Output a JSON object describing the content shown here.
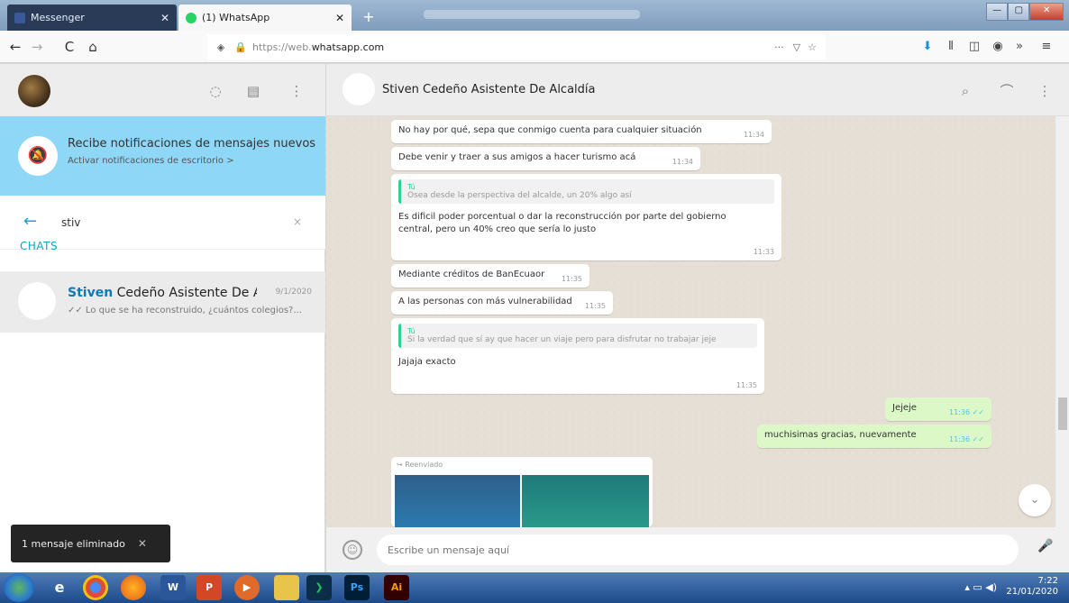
{
  "browser": {
    "tabs": [
      {
        "label": "Messenger",
        "close": "✕"
      },
      {
        "label": "(1) WhatsApp",
        "close": "✕"
      }
    ],
    "new_tab": "+",
    "url_prefix": "https://web.",
    "url_domain": "whatsapp.com",
    "url_more": "···",
    "nav": {
      "back": "←",
      "forward": "→",
      "reload": "C",
      "home": "⌂"
    },
    "window_controls": [
      "—",
      "▢",
      "✕"
    ]
  },
  "sidebar": {
    "header_icons": [
      "status-icon",
      "new-chat-icon",
      "menu-icon"
    ],
    "notification": {
      "title": "Recibe notificaciones de mensajes nuevos",
      "subtitle": "Activar notificaciones de escritorio >"
    },
    "search": {
      "value": "stiv",
      "clear": "×"
    },
    "chats_label": "CHATS",
    "chat": {
      "name_highlight": "Stiven",
      "name_rest": " Cedeño Asistente De Alc...",
      "date": "9/1/2020",
      "last_message": "✓✓ Lo que se ha reconstruido, ¿cuántos colegios?..."
    },
    "toast": {
      "text": "1 mensaje eliminado",
      "close": "✕"
    }
  },
  "conversation": {
    "contact_name": "Stiven Cedeño Asistente De Alcaldía",
    "messages": [
      {
        "text": "No hay por qué, sepa que conmigo cuenta para cualquier situación",
        "time": "11:34"
      },
      {
        "text": "Debe venir y traer a sus amigos a hacer turismo acá",
        "time": "11:34"
      },
      {
        "quote_author": "Tú",
        "quote": "Osea desde la perspectiva del alcalde, un 20% algo así",
        "text": "Es dificil poder porcentual o dar la reconstrucción por parte del gobierno central, pero un 40% creo que sería lo justo",
        "time": "11:33"
      },
      {
        "text": "Mediante créditos de BanEcuaor",
        "time": "11:35"
      },
      {
        "text": "A las personas con más vulnerabilidad",
        "time": "11:35"
      },
      {
        "quote_author": "Tú",
        "quote": "Si la verdad que sí ay que hacer un viaje pero para disfrutar no trabajar jeje",
        "text": "Jajaja exacto",
        "time": "11:35"
      }
    ],
    "outgoing": [
      {
        "text": "Jejeje",
        "time": "11:36 ✓✓"
      },
      {
        "text": "muchisimas gracias, nuevamente",
        "time": "11:36 ✓✓"
      }
    ],
    "forwarded_label": "↪ Reenviado",
    "input_placeholder": "Escribe un mensaje aquí"
  },
  "taskbar": {
    "apps": [
      "W",
      "P",
      "Ps",
      "Ai"
    ],
    "time": "7:22",
    "date": "21/01/2020"
  }
}
